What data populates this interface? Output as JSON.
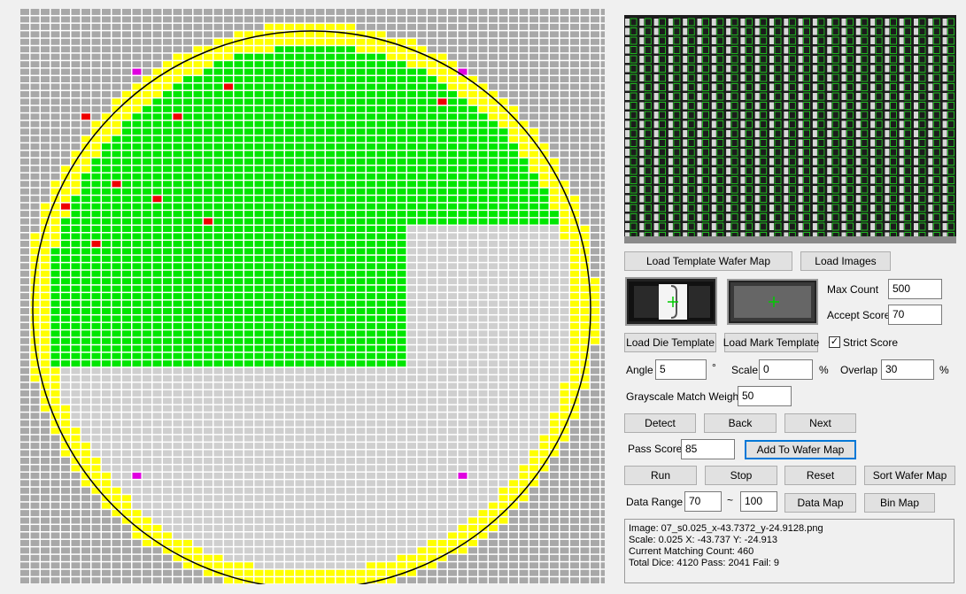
{
  "colors": {
    "grid_gray": "#a8a8a8",
    "cell_gray": "#cfcfcf",
    "cell_green": "#00e600",
    "cell_yellow": "#ffff00",
    "cell_red": "#ee0000",
    "cell_magenta": "#e000e0"
  },
  "buttons": {
    "load_template_wafer_map": "Load Template Wafer Map",
    "load_images": "Load Images",
    "load_die_template": "Load Die Template",
    "load_mark_template": "Load Mark Template",
    "detect": "Detect",
    "back": "Back",
    "next": "Next",
    "add_to_wafer_map": "Add To Wafer Map",
    "run": "Run",
    "stop": "Stop",
    "reset": "Reset",
    "sort_wafer_map": "Sort Wafer Map",
    "data_map": "Data Map",
    "bin_map": "Bin Map"
  },
  "fields": {
    "max_count": {
      "label": "Max Count",
      "value": "500"
    },
    "accept_score": {
      "label": "Accept Score",
      "value": "70"
    },
    "strict_score": {
      "label": "Strict Score",
      "checked": true
    },
    "angle": {
      "label": "Angle",
      "value": "5",
      "unit": "°"
    },
    "scale": {
      "label": "Scale",
      "value": "0",
      "unit": "%"
    },
    "overlap": {
      "label": "Overlap",
      "value": "30",
      "unit": "%"
    },
    "grayscale_weight": {
      "label": "Grayscale Match Weight",
      "value": "50"
    },
    "pass_score": {
      "label": "Pass Score",
      "value": "85"
    },
    "data_range": {
      "label": "Data Range",
      "min": "70",
      "sep": "~",
      "max": "100"
    }
  },
  "info": {
    "image": "Image: 07_s0.025_x-43.7372_y-24.9128.png",
    "scale_line": "Scale: 0.025   X: -43.737   Y: -24.913",
    "matching": "Current Matching Count: 460",
    "totals": "Total Dice: 4120   Pass: 2041   Fail: 9"
  }
}
